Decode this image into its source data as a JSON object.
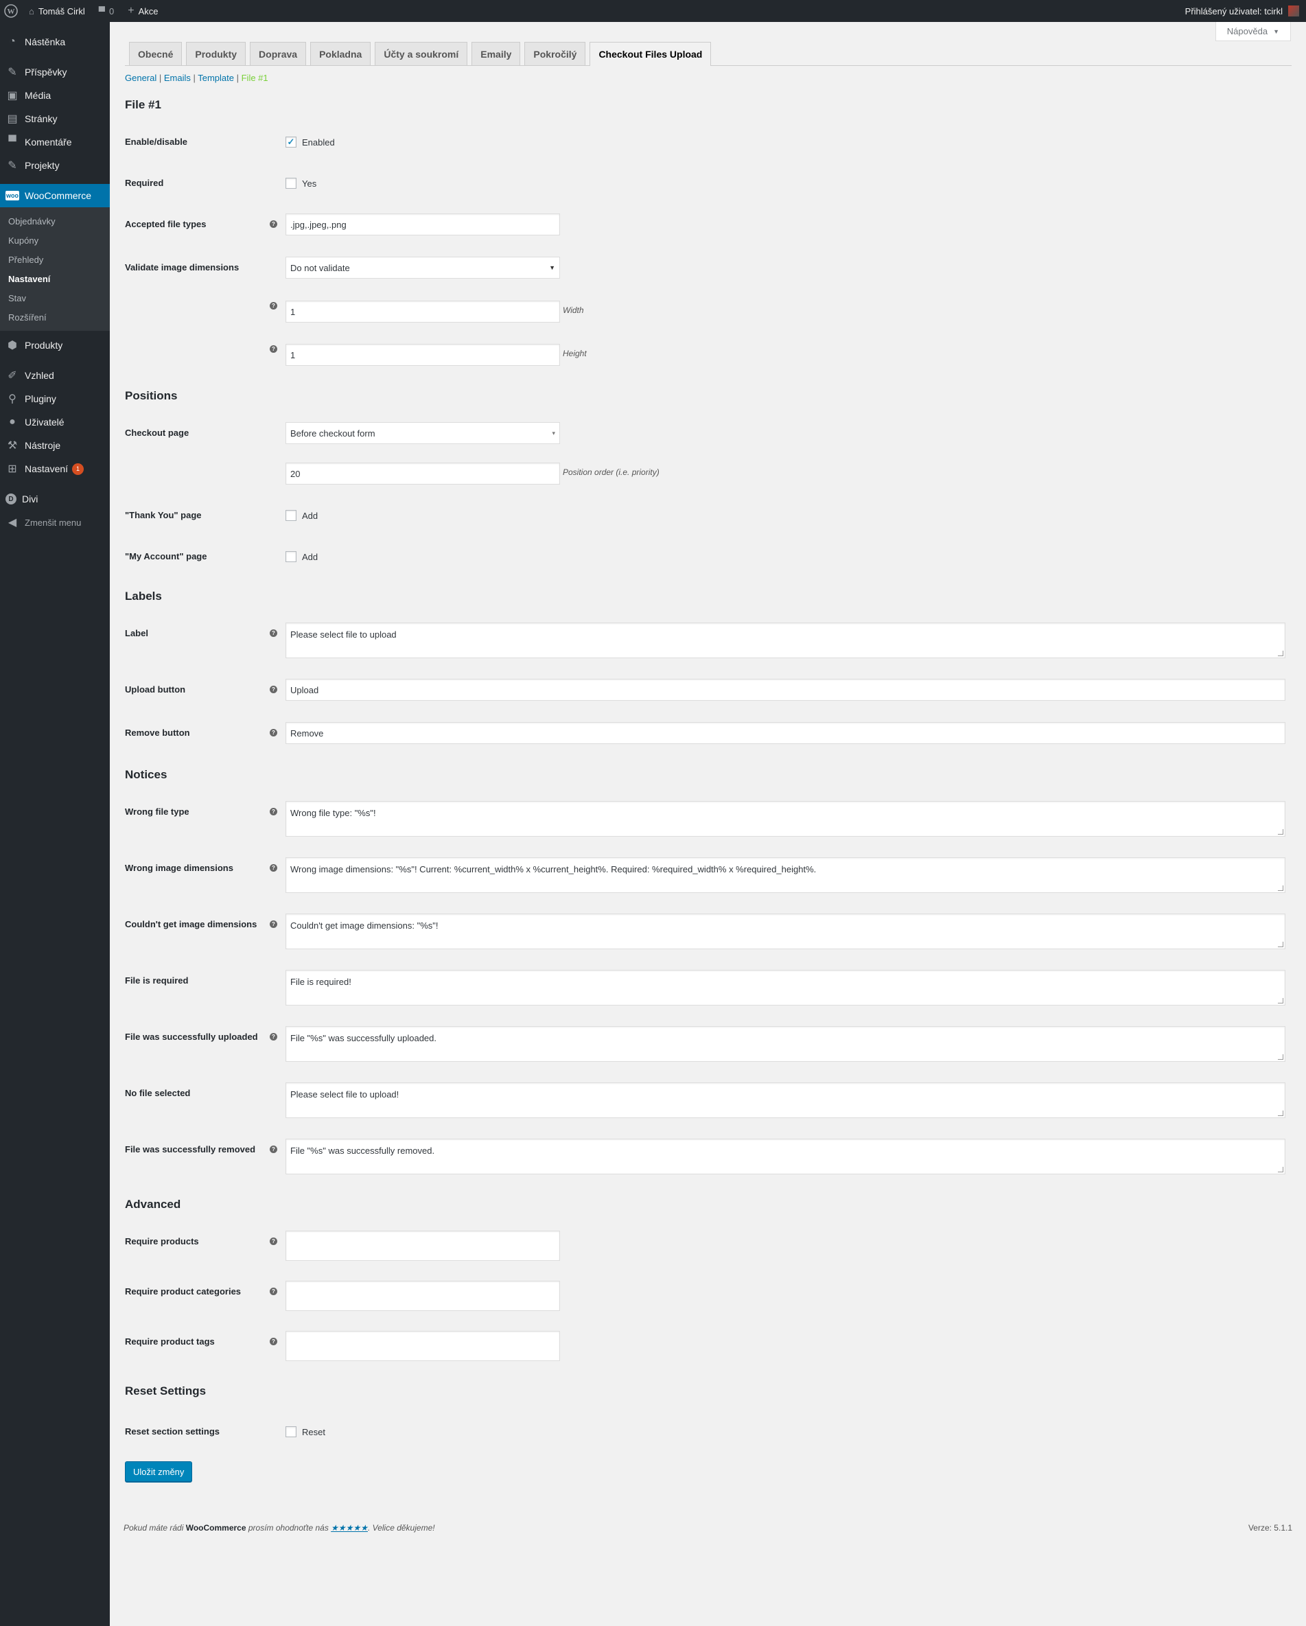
{
  "admin_bar": {
    "site_name": "Tomáš Cirkl",
    "comments_count": "0",
    "new_label": "Akce",
    "user_greeting": "Přihlášený uživatel: tcirkl"
  },
  "help_tab": {
    "label": "Nápověda"
  },
  "sidebar": {
    "items": [
      {
        "label": "Nástěnka",
        "icon": "dashboard-icon"
      },
      {
        "label": "Příspěvky",
        "icon": "pin-icon"
      },
      {
        "label": "Média",
        "icon": "media-icon"
      },
      {
        "label": "Stránky",
        "icon": "pages-icon"
      },
      {
        "label": "Komentáře",
        "icon": "comments-icon"
      },
      {
        "label": "Projekty",
        "icon": "pin-icon"
      },
      {
        "label": "WooCommerce",
        "icon": "woocommerce-icon"
      },
      {
        "label": "Produkty",
        "icon": "products-icon"
      },
      {
        "label": "Vzhled",
        "icon": "appearance-icon"
      },
      {
        "label": "Pluginy",
        "icon": "plugins-icon"
      },
      {
        "label": "Uživatelé",
        "icon": "users-icon"
      },
      {
        "label": "Nástroje",
        "icon": "tools-icon"
      },
      {
        "label": "Nastavení",
        "icon": "settings-icon",
        "badge": "1"
      },
      {
        "label": "Divi",
        "icon": "divi-icon"
      },
      {
        "label": "Zmenšit menu",
        "icon": "collapse-icon"
      }
    ],
    "woo_submenu": [
      "Objednávky",
      "Kupóny",
      "Přehledy",
      "Nastavení",
      "Stav",
      "Rozšíření"
    ]
  },
  "tabs": [
    "Obecné",
    "Produkty",
    "Doprava",
    "Pokladna",
    "Účty a soukromí",
    "Emaily",
    "Pokročilý",
    "Checkout Files Upload"
  ],
  "subnav": {
    "general": "General",
    "emails": "Emails",
    "template": "Template",
    "file1": "File #1"
  },
  "sections": {
    "file": {
      "title": "File #1",
      "enable_label": "Enable/disable",
      "enable_value": "Enabled",
      "required_label": "Required",
      "required_value": "Yes",
      "file_types_label": "Accepted file types",
      "file_types_value": ".jpg,.jpeg,.png",
      "validate_label": "Validate image dimensions",
      "validate_value": "Do not validate",
      "width_value": "1",
      "width_label": "Width",
      "height_value": "1",
      "height_label": "Height"
    },
    "positions": {
      "title": "Positions",
      "checkout_label": "Checkout page",
      "checkout_value": "Before checkout form",
      "order_value": "20",
      "order_label": "Position order (i.e. priority)",
      "thankyou_label": "\"Thank You\" page",
      "thankyou_value": "Add",
      "myaccount_label": "\"My Account\" page",
      "myaccount_value": "Add"
    },
    "labels": {
      "title": "Labels",
      "label_label": "Label",
      "label_value": "Please select file to upload",
      "upload_label": "Upload button",
      "upload_value": "Upload",
      "remove_label": "Remove button",
      "remove_value": "Remove"
    },
    "notices": {
      "title": "Notices",
      "wrong_type_label": "Wrong file type",
      "wrong_type_value": "Wrong file type: \"%s\"!",
      "wrong_dim_label": "Wrong image dimensions",
      "wrong_dim_value": "Wrong image dimensions: \"%s\"! Current: %current_width% x %current_height%. Required: %required_width% x %required_height%.",
      "no_dim_label": "Couldn't get image dimensions",
      "no_dim_value": "Couldn't get image dimensions: \"%s\"!",
      "required_label": "File is required",
      "required_value": "File is required!",
      "uploaded_label": "File was successfully uploaded",
      "uploaded_value": "File \"%s\" was successfully uploaded.",
      "no_file_label": "No file selected",
      "no_file_value": "Please select file to upload!",
      "removed_label": "File was successfully removed",
      "removed_value": "File \"%s\" was successfully removed."
    },
    "advanced": {
      "title": "Advanced",
      "products_label": "Require products",
      "categories_label": "Require product categories",
      "tags_label": "Require product tags"
    },
    "reset": {
      "title": "Reset Settings",
      "reset_label": "Reset section settings",
      "reset_value": "Reset"
    }
  },
  "save_button": "Uložit změny",
  "footer": {
    "text_before": "Pokud máte rádi ",
    "brand": "WooCommerce",
    "text_middle": " prosím ohodnoťte nás ",
    "stars": "★★★★★",
    "text_after": ". Velice děkujeme!",
    "version": "Verze: 5.1.1"
  },
  "colors": {
    "accent": "#0073aa",
    "admin_dark": "#23282d",
    "current_link": "#7ad03a"
  }
}
